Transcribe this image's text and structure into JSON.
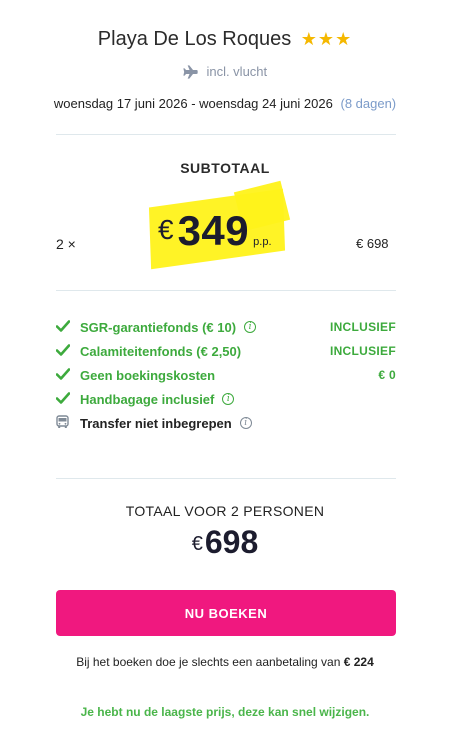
{
  "hotel": {
    "name": "Playa De Los Roques",
    "stars": "★★★"
  },
  "flight": {
    "icon": "airplane-icon",
    "label": "incl. vlucht"
  },
  "dates": {
    "range": "woensdag 17 juni 2026 - woensdag 24 juni 2026",
    "duration": "(8 dagen)"
  },
  "subtotal": {
    "title": "SUBTOTAAL",
    "quantity": "2 ×",
    "currency": "€",
    "price": "349",
    "per_person": "p.p.",
    "sum": "€ 698",
    "highlight_color": "#fff21a"
  },
  "features": [
    {
      "icon": "check-icon",
      "label": "SGR-garantiefonds  (€ 10)",
      "info": true,
      "value": "INCLUSIEF",
      "color": "#3daa3d"
    },
    {
      "icon": "check-icon",
      "label": "Calamiteitenfonds  (€ 2,50)",
      "info": false,
      "value": "INCLUSIEF",
      "color": "#3daa3d"
    },
    {
      "icon": "check-icon",
      "label": "Geen boekingskosten",
      "info": false,
      "value": "€ 0",
      "color": "#3daa3d"
    },
    {
      "icon": "check-icon",
      "label": "Handbagage inclusief",
      "info": true,
      "value": "",
      "color": "#3daa3d"
    },
    {
      "icon": "bus-icon",
      "label": "Transfer niet inbegrepen",
      "info": true,
      "value": "",
      "color": "#222222"
    }
  ],
  "total": {
    "title": "TOTAAL VOOR 2 PERSONEN",
    "currency": "€",
    "amount": "698"
  },
  "book_button": {
    "label": "NU BOEKEN",
    "color": "#f0187f"
  },
  "deposit": {
    "text": "Bij het boeken doe je slechts een aanbetaling van",
    "amount": "€ 224"
  },
  "notice": {
    "text": "Je hebt nu de laagste prijs, deze kan snel wijzigen."
  }
}
